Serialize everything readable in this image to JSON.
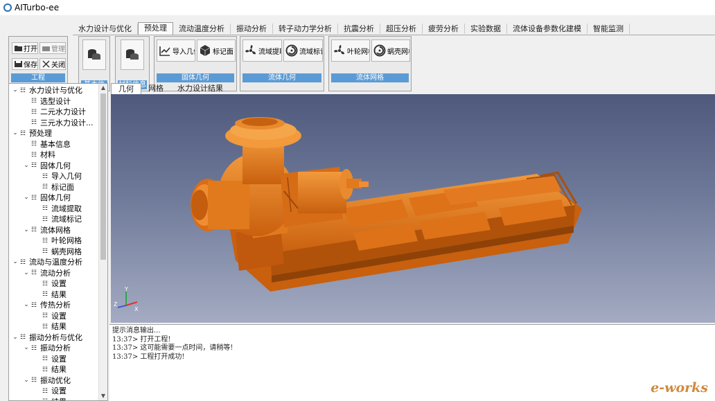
{
  "app": {
    "title": "AITurbo-ee"
  },
  "ribbon": {
    "tabs": [
      "水力设计与优化",
      "预处理",
      "流动温度分析",
      "振动分析",
      "转子动力学分析",
      "抗震分析",
      "超压分析",
      "疲劳分析",
      "实验数据",
      "流体设备参数化建模",
      "智能监测"
    ],
    "active_tab": "预处理",
    "project_group": {
      "label": "工程",
      "buttons": [
        {
          "label": "打开",
          "icon": "folder-open-icon"
        },
        {
          "label": "管理",
          "icon": "manage-icon"
        },
        {
          "label": "保存",
          "icon": "save-icon"
        },
        {
          "label": "关闭",
          "icon": "close-icon"
        }
      ]
    },
    "basic_info": {
      "label": "基本信息",
      "icon": "database-icon"
    },
    "material_info": {
      "label": "材料信息",
      "icon": "database-icon"
    },
    "solid_geometry": {
      "label": "固体几何",
      "buttons": [
        {
          "label": "导入几何",
          "icon": "import-chart-icon"
        },
        {
          "label": "标记面",
          "icon": "cube-icon"
        }
      ]
    },
    "fluid_geometry": {
      "label": "流体几何",
      "buttons": [
        {
          "label": "流域提取",
          "icon": "impeller-icon"
        },
        {
          "label": "流域标记",
          "icon": "volute-icon"
        }
      ]
    },
    "fluid_mesh": {
      "label": "流体网格",
      "buttons": [
        {
          "label": "叶轮网格",
          "icon": "impeller-icon"
        },
        {
          "label": "蜗壳网格",
          "icon": "volute-icon"
        }
      ]
    }
  },
  "tree": {
    "items": [
      {
        "label": "水力设计与优化",
        "toggle": "expanded",
        "level": 0
      },
      {
        "label": "选型设计",
        "toggle": "",
        "level": 1
      },
      {
        "label": "二元水力设计",
        "toggle": "",
        "level": 1
      },
      {
        "label": "三元水力设计...",
        "toggle": "",
        "level": 1
      },
      {
        "label": "预处理",
        "toggle": "expanded",
        "level": 0
      },
      {
        "label": "基本信息",
        "toggle": "",
        "level": 1
      },
      {
        "label": "材料",
        "toggle": "",
        "level": 1
      },
      {
        "label": "固体几何",
        "toggle": "expanded",
        "level": 1
      },
      {
        "label": "导入几何",
        "toggle": "",
        "level": 2
      },
      {
        "label": "标记面",
        "toggle": "",
        "level": 2
      },
      {
        "label": "固体几何",
        "toggle": "expanded",
        "level": 1
      },
      {
        "label": "流域提取",
        "toggle": "",
        "level": 2
      },
      {
        "label": "流域标记",
        "toggle": "",
        "level": 2
      },
      {
        "label": "流体网格",
        "toggle": "expanded",
        "level": 1
      },
      {
        "label": "叶轮网格",
        "toggle": "",
        "level": 2
      },
      {
        "label": "蜗壳网格",
        "toggle": "",
        "level": 2
      },
      {
        "label": "流动与温度分析",
        "toggle": "expanded",
        "level": 0
      },
      {
        "label": "流动分析",
        "toggle": "expanded",
        "level": 1
      },
      {
        "label": "设置",
        "toggle": "",
        "level": 2
      },
      {
        "label": "结果",
        "toggle": "",
        "level": 2
      },
      {
        "label": "传热分析",
        "toggle": "expanded",
        "level": 1
      },
      {
        "label": "设置",
        "toggle": "",
        "level": 2
      },
      {
        "label": "结果",
        "toggle": "",
        "level": 2
      },
      {
        "label": "振动分析与优化",
        "toggle": "expanded",
        "level": 0
      },
      {
        "label": "振动分析",
        "toggle": "expanded",
        "level": 1
      },
      {
        "label": "设置",
        "toggle": "",
        "level": 2
      },
      {
        "label": "结果",
        "toggle": "",
        "level": 2
      },
      {
        "label": "振动优化",
        "toggle": "expanded",
        "level": 1
      },
      {
        "label": "设置",
        "toggle": "",
        "level": 2
      },
      {
        "label": "结果",
        "toggle": "",
        "level": 2
      }
    ]
  },
  "view_tabs": {
    "items": [
      "几何",
      "网格",
      "水力设计结果"
    ],
    "active": "几何"
  },
  "viewport": {
    "model_color": "#e07a1c",
    "axes": {
      "x": "X",
      "y": "Y",
      "z": "Z"
    }
  },
  "console": {
    "lines": [
      "提示消息输出...",
      "13:37> 打开工程!",
      "13:37> 这可能需要一点时间，请稍等!",
      "13:37> 工程打开成功!"
    ]
  },
  "watermark": "e-works"
}
